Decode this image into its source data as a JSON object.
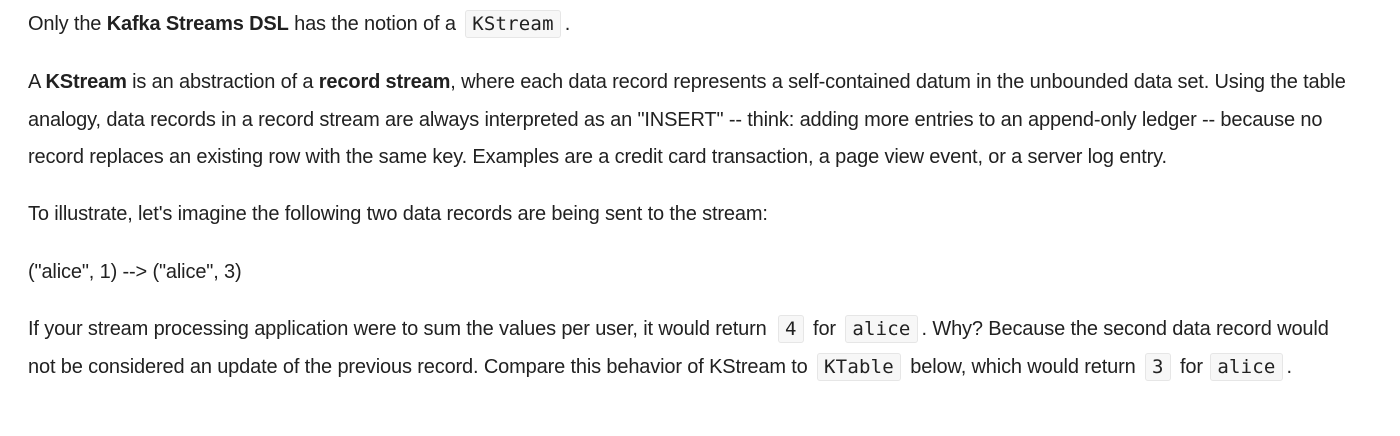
{
  "paragraphs": {
    "p1": {
      "t1": "Only the ",
      "b1": "Kafka Streams DSL",
      "t2": " has the notion of a ",
      "c1": "KStream",
      "t3": "."
    },
    "p2": {
      "t1": "A ",
      "b1": "KStream",
      "t2": " is an abstraction of a ",
      "b2": "record stream",
      "t3": ", where each data record represents a self-contained datum in the unbounded data set. Using the table analogy, data records in a record stream are always interpreted as an \"INSERT\" -- think: adding more entries to an append-only ledger -- because no record replaces an existing row with the same key. Examples are a credit card transaction, a page view event, or a server log entry."
    },
    "p3": {
      "t1": "To illustrate, let's imagine the following two data records are being sent to the stream:"
    },
    "p4": {
      "t1": "(\"alice\", 1) --> (\"alice\", 3)"
    },
    "p5": {
      "t1": "If your stream processing application were to sum the values per user, it would return ",
      "c1": "4",
      "t2": " for ",
      "c2": "alice",
      "t3": ". Why? Because the second data record would not be considered an update of the previous record. Compare this behavior of KStream to ",
      "c3": "KTable",
      "t4": " below, which would return ",
      "c4": "3",
      "t5": " for ",
      "c5": "alice",
      "t6": "."
    }
  }
}
